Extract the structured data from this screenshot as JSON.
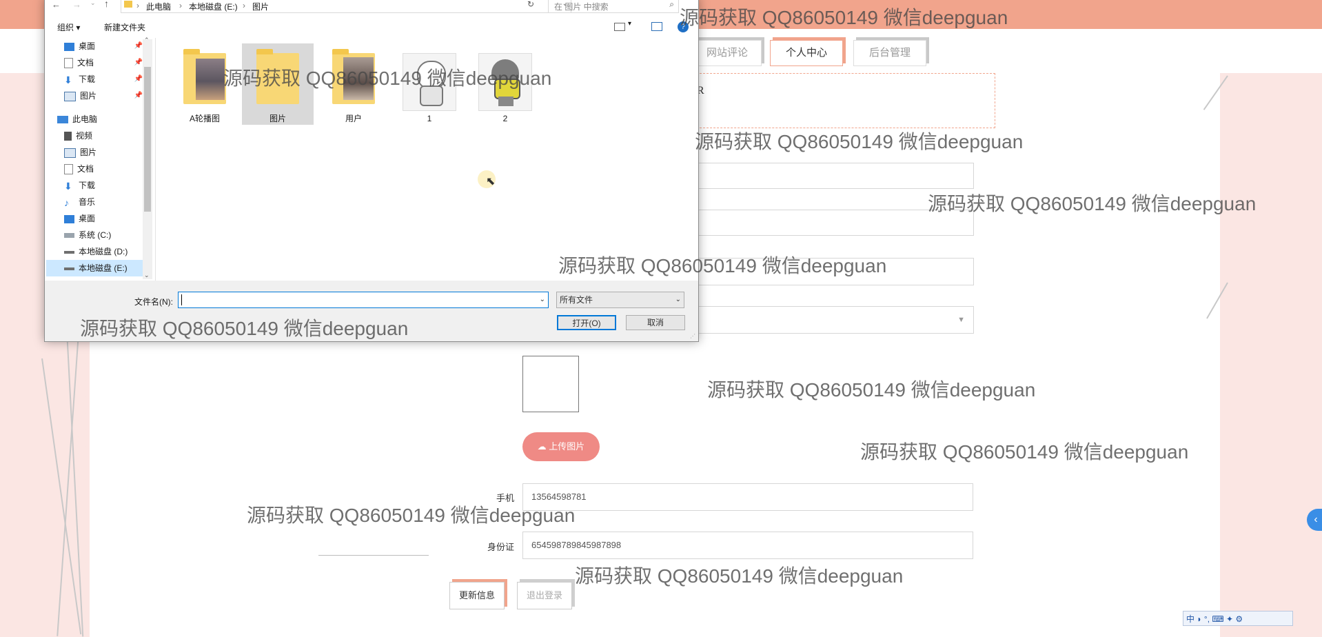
{
  "web": {
    "nav_tabs": [
      "网站评论",
      "个人中心",
      "后台管理"
    ],
    "form": {
      "upload_label": "上传图片",
      "phone_label": "手机",
      "phone_value": "13564598781",
      "id_label": "身份证",
      "id_value": "654598789845987898",
      "update_label": "更新信息",
      "logout_label": "退出登录",
      "partial_text": "R"
    },
    "side_arrow": "‹",
    "ime_text": "中 ◗ °, ⌨ ✦ ⚙"
  },
  "dialog": {
    "breadcrumb": [
      "此电脑",
      "本地磁盘 (E:)",
      "图片"
    ],
    "search_placeholder": "在 图片 中搜索",
    "toolbar": {
      "organize": "组织 ▾",
      "new_folder": "新建文件夹",
      "help": "?"
    },
    "sidebar": [
      {
        "label": "桌面",
        "icon": "desktop-icon",
        "pinned": true
      },
      {
        "label": "文档",
        "icon": "document-icon",
        "pinned": true
      },
      {
        "label": "下载",
        "icon": "download-icon",
        "pinned": true
      },
      {
        "label": "图片",
        "icon": "pictures-icon",
        "pinned": true
      },
      {
        "label": "此电脑",
        "icon": "computer-icon",
        "pinned": false
      },
      {
        "label": "视频",
        "icon": "video-icon",
        "pinned": false
      },
      {
        "label": "图片",
        "icon": "pictures-icon",
        "pinned": false
      },
      {
        "label": "文档",
        "icon": "document-icon",
        "pinned": false
      },
      {
        "label": "下载",
        "icon": "download-icon",
        "pinned": false
      },
      {
        "label": "音乐",
        "icon": "music-icon",
        "pinned": false
      },
      {
        "label": "桌面",
        "icon": "desktop-icon",
        "pinned": false
      },
      {
        "label": "系统 (C:)",
        "icon": "drive-icon",
        "pinned": false
      },
      {
        "label": "本地磁盘 (D:)",
        "icon": "drive-icon",
        "pinned": false
      },
      {
        "label": "本地磁盘 (E:)",
        "icon": "drive-icon",
        "pinned": false
      }
    ],
    "files": [
      {
        "label": "A轮播图",
        "type": "folder"
      },
      {
        "label": "图片",
        "type": "folder"
      },
      {
        "label": "用户",
        "type": "folder"
      },
      {
        "label": "1",
        "type": "image"
      },
      {
        "label": "2",
        "type": "image"
      }
    ],
    "filename_label": "文件名(N):",
    "filename_value": "",
    "filetype_value": "所有文件",
    "open_label": "打开(O)",
    "cancel_label": "取消"
  },
  "watermark": "源码获取 QQ86050149 微信deepguan",
  "colors": {
    "accent": "#f1a48c",
    "upload": "#ef8a85",
    "blue": "#0078d7"
  }
}
